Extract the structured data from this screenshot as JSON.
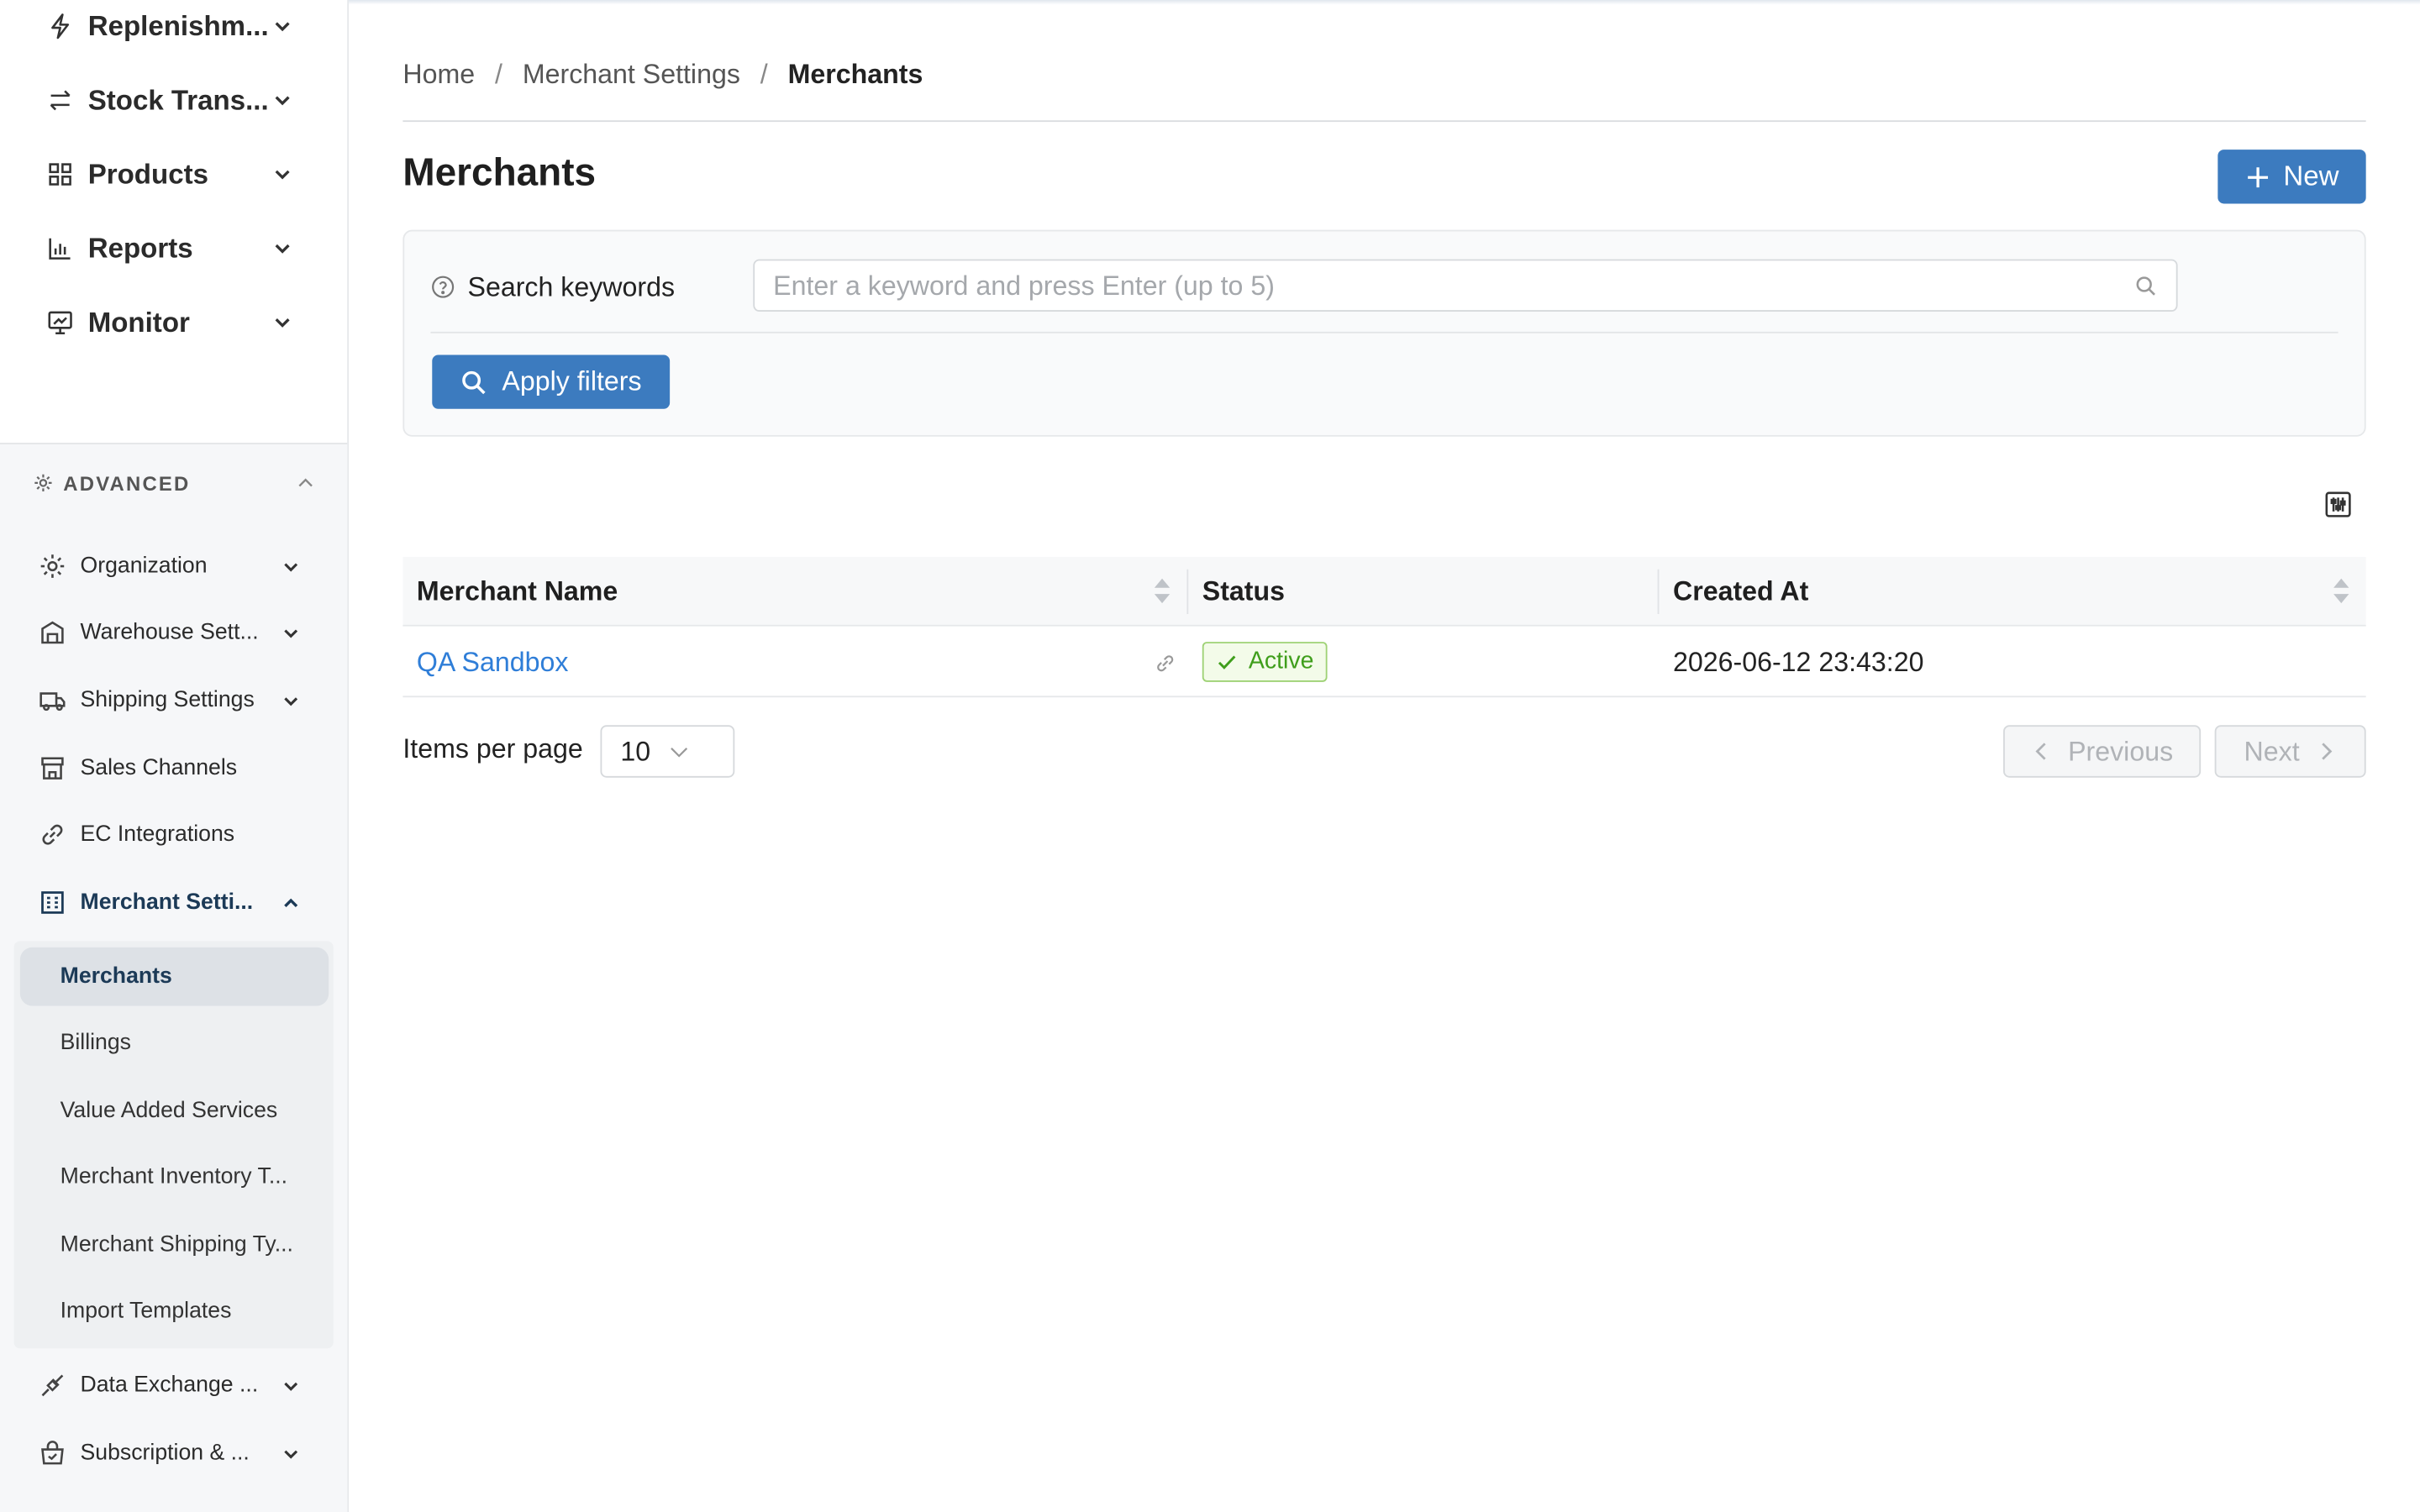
{
  "sidebar": {
    "top_items": [
      {
        "label": "Replenishm...",
        "icon": "bolt-icon"
      },
      {
        "label": "Stock Trans...",
        "icon": "transfer-arrows-icon"
      },
      {
        "label": "Products",
        "icon": "grid-icon"
      },
      {
        "label": "Reports",
        "icon": "bar-chart-icon"
      },
      {
        "label": "Monitor",
        "icon": "monitor-icon"
      }
    ],
    "advanced_label": "ADVANCED",
    "advanced_items": [
      {
        "label": "Organization",
        "icon": "gear-icon"
      },
      {
        "label": "Warehouse Sett...",
        "icon": "warehouse-icon"
      },
      {
        "label": "Shipping Settings",
        "icon": "truck-icon"
      },
      {
        "label": "Sales Channels",
        "icon": "store-icon"
      },
      {
        "label": "EC Integrations",
        "icon": "link-icon"
      },
      {
        "label": "Merchant Setti...",
        "icon": "merchant-settings-icon"
      }
    ],
    "merchant_sub_items": [
      {
        "label": "Merchants"
      },
      {
        "label": "Billings"
      },
      {
        "label": "Value Added Services"
      },
      {
        "label": "Merchant Inventory T..."
      },
      {
        "label": "Merchant Shipping Ty..."
      },
      {
        "label": "Import Templates"
      }
    ],
    "bottom_items": [
      {
        "label": "Data Exchange ...",
        "icon": "data-exchange-icon"
      },
      {
        "label": "Subscription & ...",
        "icon": "subscription-icon"
      }
    ]
  },
  "breadcrumb": {
    "items": [
      "Home",
      "Merchant Settings",
      "Merchants"
    ],
    "separator": "/"
  },
  "page": {
    "title": "Merchants",
    "new_button": "New"
  },
  "filters": {
    "search_label": "Search keywords",
    "search_placeholder": "Enter a keyword and press Enter (up to 5)",
    "search_value": "",
    "apply_button": "Apply filters"
  },
  "table": {
    "columns": [
      "Merchant Name",
      "Status",
      "Created At"
    ],
    "rows": [
      {
        "merchant_name": "QA Sandbox",
        "status": "Active",
        "created_at": "2026-06-12 23:43:20"
      }
    ]
  },
  "pagination": {
    "items_per_page_label": "Items per page",
    "items_per_page_value": "10",
    "previous": "Previous",
    "next": "Next"
  },
  "colors": {
    "primary": "#3c7bbf",
    "link": "#2f7ed8",
    "active_status": "#3f9e1b"
  }
}
